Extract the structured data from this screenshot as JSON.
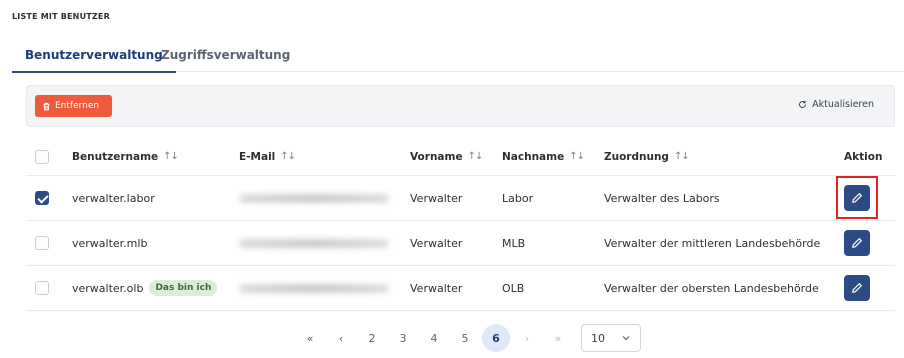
{
  "section_title": "LISTE MIT BENUTZER",
  "tabs": [
    {
      "label": "Benutzerverwaltung",
      "active": true
    },
    {
      "label": "Zugriffsverwaltung",
      "active": false
    }
  ],
  "toolbar": {
    "remove_label": "Entfernen",
    "refresh_label": "Aktualisieren"
  },
  "table": {
    "columns": {
      "username": "Benutzername",
      "email": "E-Mail",
      "first_name": "Vorname",
      "last_name": "Nachname",
      "assignment": "Zuordnung",
      "action": "Aktion"
    },
    "rows": [
      {
        "username": "verwalter.labor",
        "first_name": "Verwalter",
        "last_name": "Labor",
        "assignment": "Verwalter des Labors",
        "checked": true,
        "badge": ""
      },
      {
        "username": "verwalter.mlb",
        "first_name": "Verwalter",
        "last_name": "MLB",
        "assignment": "Verwalter der mittleren Landesbehörde",
        "checked": false,
        "badge": ""
      },
      {
        "username": "verwalter.olb",
        "first_name": "Verwalter",
        "last_name": "OLB",
        "assignment": "Verwalter der obersten Landesbehörde",
        "checked": false,
        "badge": "Das bin ich"
      }
    ]
  },
  "pagination": {
    "first": "«",
    "prev": "‹",
    "pages": [
      "2",
      "3",
      "4",
      "5",
      "6"
    ],
    "current_page": "6",
    "next": "›",
    "last": "»",
    "page_size": "10"
  },
  "colors": {
    "primary": "#2c4a85",
    "danger": "#f05a3c",
    "highlight": "#e02323",
    "badge_bg": "#d9efd5"
  },
  "icons": {
    "remove": "trash-icon",
    "refresh": "refresh-icon",
    "edit": "pencil-icon",
    "sort": "sort-icon",
    "dropdown": "chevron-down-icon"
  }
}
